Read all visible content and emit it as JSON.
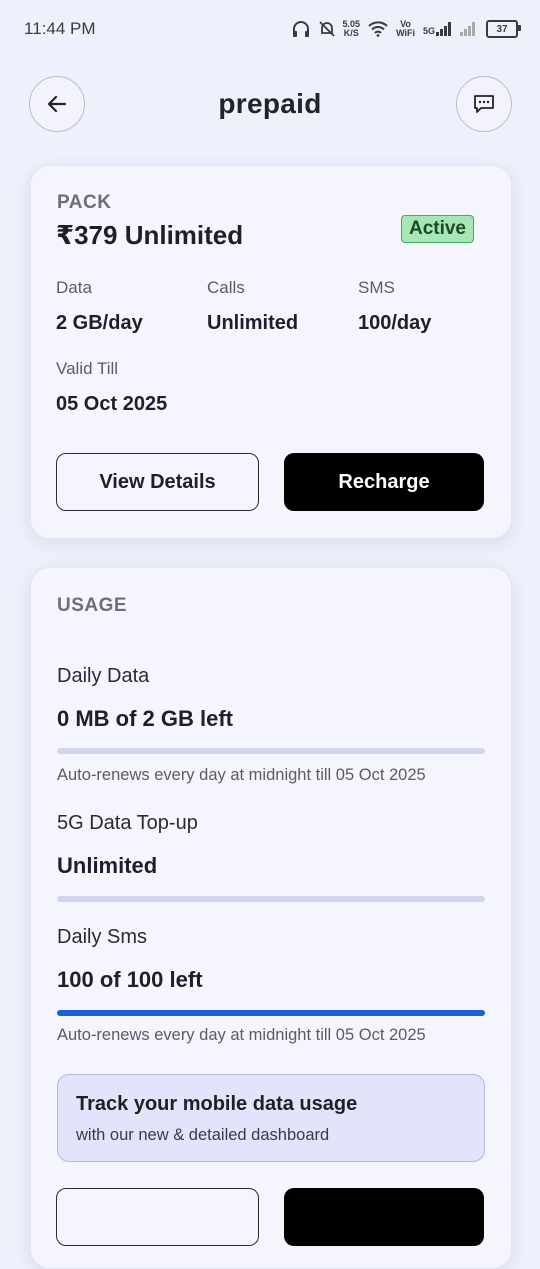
{
  "status_bar": {
    "time": "11:44 PM",
    "speed_value": "5.05",
    "speed_unit": "K/S",
    "vowifi_top": "Vo",
    "vowifi_bottom": "WiFi",
    "network": "5G",
    "battery": "37"
  },
  "header": {
    "title": "prepaid"
  },
  "pack": {
    "section_label": "PACK",
    "name": "₹379 Unlimited",
    "status": "Active",
    "data_label": "Data",
    "data_value": "2 GB/day",
    "calls_label": "Calls",
    "calls_value": "Unlimited",
    "sms_label": "SMS",
    "sms_value": "100/day",
    "valid_label": "Valid Till",
    "valid_value": "05 Oct 2025",
    "view_details_label": "View Details",
    "recharge_label": "Recharge"
  },
  "usage": {
    "section_label": "USAGE",
    "daily_data_label": "Daily Data",
    "daily_data_value": "0 MB of 2 GB left",
    "daily_data_fraction": 0,
    "daily_data_note": "Auto-renews every day at midnight till 05 Oct 2025",
    "topup_label": "5G Data Top-up",
    "topup_value": "Unlimited",
    "daily_sms_label": "Daily Sms",
    "daily_sms_value": "100 of 100 left",
    "daily_sms_fraction": 1,
    "daily_sms_note": "Auto-renews every day at midnight till 05 Oct 2025",
    "promo_title": "Track your mobile data usage",
    "promo_subtitle": "with our new & detailed dashboard"
  },
  "colors": {
    "accent_blue": "#1b5fd9",
    "active_green": "#a8e6b5",
    "background": "#eef0fb"
  }
}
